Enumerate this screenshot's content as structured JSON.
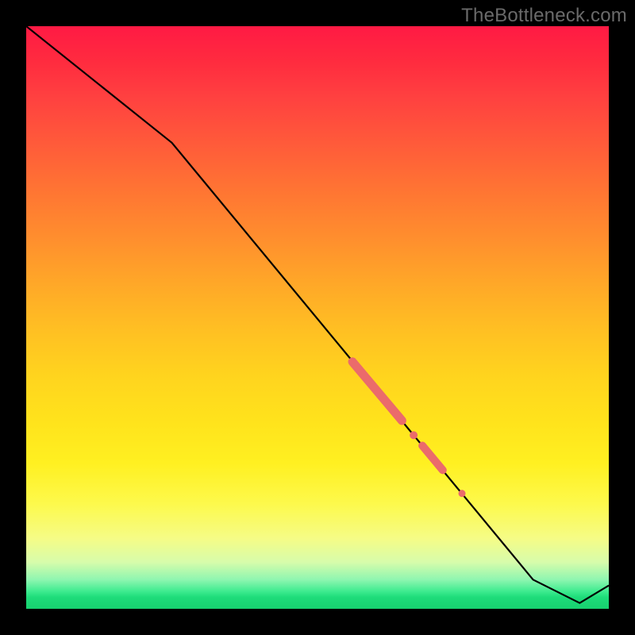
{
  "watermark": "TheBottleneck.com",
  "chart_data": {
    "type": "line",
    "title": "",
    "xlabel": "",
    "ylabel": "",
    "xlim": [
      0,
      100
    ],
    "ylim": [
      0,
      100
    ],
    "series": [
      {
        "name": "curve",
        "points": [
          {
            "x": 0,
            "y": 100
          },
          {
            "x": 25,
            "y": 80
          },
          {
            "x": 87,
            "y": 5
          },
          {
            "x": 95,
            "y": 1
          },
          {
            "x": 100,
            "y": 4
          }
        ]
      }
    ],
    "markers": [
      {
        "name": "segment",
        "x1": 56.0,
        "y1": 42.4,
        "x2": 64.5,
        "y2": 32.3,
        "r": 5.5
      },
      {
        "name": "dot",
        "x": 66.5,
        "y": 29.8,
        "r": 5.0
      },
      {
        "name": "segment",
        "x1": 68.0,
        "y1": 28.0,
        "x2": 71.5,
        "y2": 23.8,
        "r": 5.0
      },
      {
        "name": "dot",
        "x": 74.8,
        "y": 19.8,
        "r": 4.5
      }
    ],
    "background_gradient": {
      "top": "#ff1a44",
      "mid": "#ffe31c",
      "bottom": "#17d16f"
    }
  }
}
